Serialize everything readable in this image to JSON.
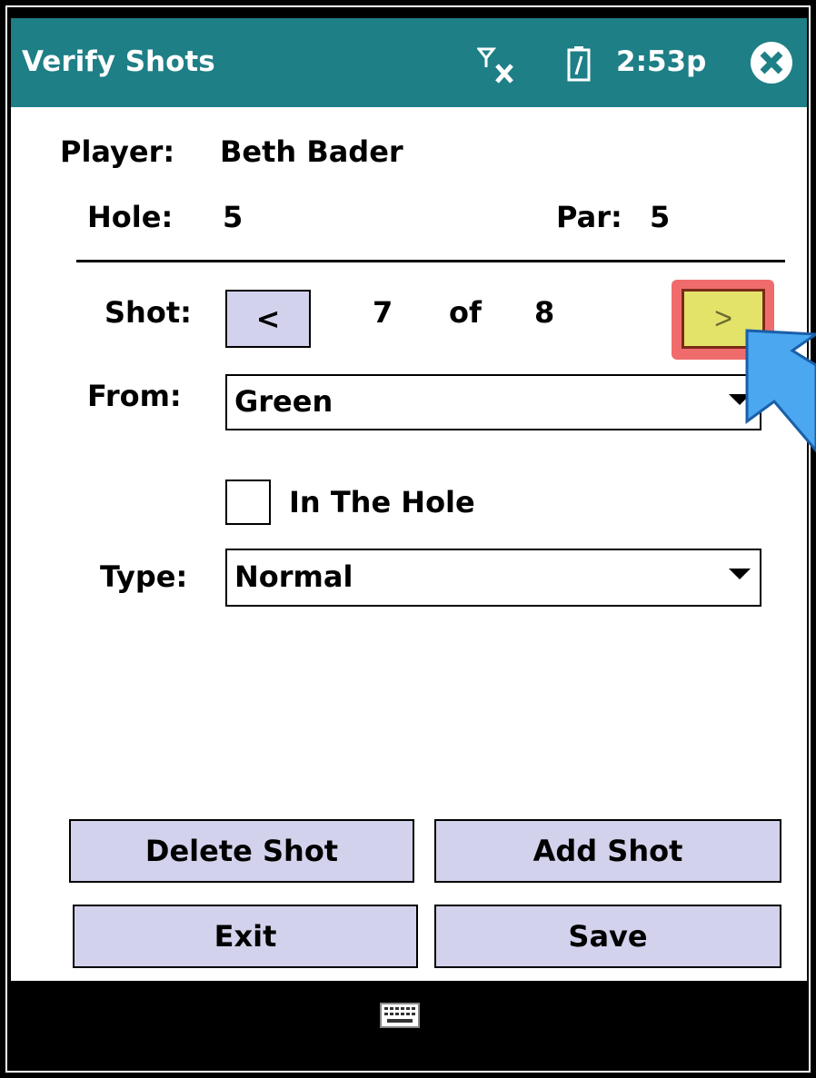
{
  "titlebar": {
    "title": "Verify Shots",
    "time": "2:53p",
    "signal_icon": "signal-off-icon",
    "battery_icon": "battery-icon",
    "close_icon": "close-icon"
  },
  "player": {
    "label": "Player:",
    "value": "Beth Bader"
  },
  "hole": {
    "label": "Hole:",
    "value": "5"
  },
  "par": {
    "label": "Par:",
    "value": "5"
  },
  "shot": {
    "label": "Shot:",
    "prev_label": "<",
    "current": "7",
    "of_label": "of",
    "total": "8",
    "next_label": ">"
  },
  "from": {
    "label": "From:",
    "value": "Green"
  },
  "in_the_hole": {
    "label": "In The Hole",
    "checked": false
  },
  "type": {
    "label": "Type:",
    "value": "Normal"
  },
  "buttons": {
    "delete_shot": "Delete Shot",
    "add_shot": "Add Shot",
    "exit": "Exit",
    "save": "Save"
  },
  "bottombar": {
    "keyboard_icon": "keyboard-icon"
  },
  "colors": {
    "titlebar": "#1e7f86",
    "button": "#d2d2ec",
    "next_highlight": "#e3e36a",
    "highlight_outline": "#f06c6c",
    "pointer_arrow": "#4aa7f0"
  }
}
